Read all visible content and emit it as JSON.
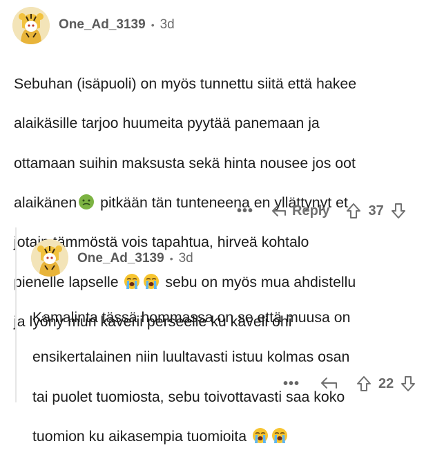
{
  "comments": [
    {
      "username": "One_Ad_3139",
      "separator": "•",
      "age": "3d",
      "lines": [
        "Sebuhan (isäpuoli) on myös tunnettu siitä että hakee",
        "alaikäsille tarjoo huumeita pyytää panemaan ja",
        "ottamaan suihin maksusta sekä hinta nousee jos oot",
        "pitkään tän tunteneena en yllättynyt et",
        "jotain tämmöstä vois tapahtua, hirveä kohtalo",
        "pienelle lapselle",
        "sebu on myös mua ahdistellu",
        "ja lyöny mun kaverii perseelle ku käveli ohi"
      ],
      "line4_prefix": "alaikänen",
      "more_label": "•••",
      "reply_label": "Reply",
      "votes": "37"
    },
    {
      "username": "One_Ad_3139",
      "separator": "•",
      "age": "3d",
      "lines": [
        "Kamalinta tässä hommassa on se että muusa on",
        "ensikertalainen niin luultavasti istuu kolmas osan",
        "tai puolet tuomiosta, sebu toivottavasti saa koko",
        "tuomion ku aikasempia tuomioita"
      ],
      "more_label": "•••",
      "votes": "22"
    }
  ],
  "icons": {
    "nauseated": "nauseated-face-icon",
    "crying": "loudly-crying-face-icon",
    "reply": "reply-arrow-icon",
    "upvote": "upvote-arrow-icon",
    "downvote": "downvote-arrow-icon"
  }
}
